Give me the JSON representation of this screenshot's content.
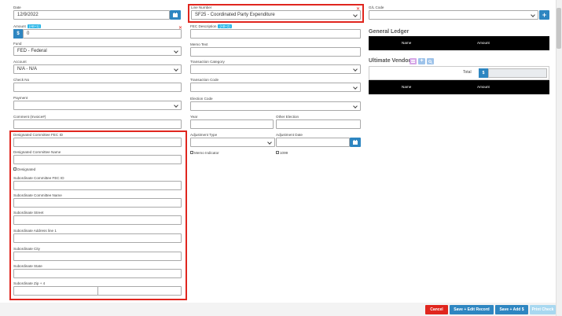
{
  "date": {
    "label": "Date",
    "value": "12/9/2022"
  },
  "line_number": {
    "label": "Line Number",
    "value": "SF25 - Coordinated Party Expenditure"
  },
  "gl_code": {
    "label": "G/L Code",
    "value": ""
  },
  "amount": {
    "label": "Amount",
    "badge": "(AB+1)",
    "currency": "$",
    "value": "0"
  },
  "fec_description": {
    "label": "FEC Description",
    "badge": "(AB+2)",
    "value": ""
  },
  "fund": {
    "label": "Fund",
    "value": "FED - Federal"
  },
  "memo_text": {
    "label": "Memo Text",
    "value": ""
  },
  "account": {
    "label": "Account",
    "value": "N/A - N/A"
  },
  "transaction_category": {
    "label": "Transaction Category",
    "value": ""
  },
  "check_no": {
    "label": "Check No",
    "value": ""
  },
  "transaction_code": {
    "label": "Transaction Code",
    "value": ""
  },
  "payment": {
    "label": "Payment",
    "value": ""
  },
  "election_code": {
    "label": "Election Code",
    "value": ""
  },
  "comment": {
    "label": "Comment (Invoice#)",
    "value": ""
  },
  "year": {
    "label": "Year",
    "value": ""
  },
  "other_election": {
    "label": "Other Election",
    "value": ""
  },
  "adjustment_type": {
    "label": "Adjustment Type",
    "value": ""
  },
  "adjustment_date": {
    "label": "Adjustment Date",
    "value": ""
  },
  "memo_indicator": {
    "label": "Memo Indicator"
  },
  "form1099": {
    "label": "1099"
  },
  "designated": {
    "fec_id_label": "Designated Committee FEC ID",
    "name_label": "Designated Committee Name",
    "checkbox_label": "Designated"
  },
  "subordinate": {
    "fec_id_label": "Subordinate Committee FEC ID",
    "name_label": "Subordinate Committee Name",
    "street_label": "Subordinate Street",
    "address2_label": "Subordinate Address line 1",
    "city_label": "Subordinate City",
    "state_label": "Subordinate State",
    "zip_label": "Subordinate Zip + 4"
  },
  "general_ledger": {
    "title": "General Ledger",
    "columns": [
      "Name",
      "Amount"
    ]
  },
  "ultimate_vendor": {
    "title": "Ultimate Vendor",
    "total_label": "Total",
    "currency": "$",
    "columns": [
      "Name",
      "Amount"
    ]
  },
  "buttons": {
    "cancel": "Cancel",
    "save_edit": "Save + Edit Record",
    "save_add": "Save + Add $",
    "print_check": "Print Check"
  },
  "colors": {
    "primary": "#2e86c1",
    "danger": "#e0261e",
    "badge": "#29b6e8",
    "disabled": "#a8d8f0"
  }
}
